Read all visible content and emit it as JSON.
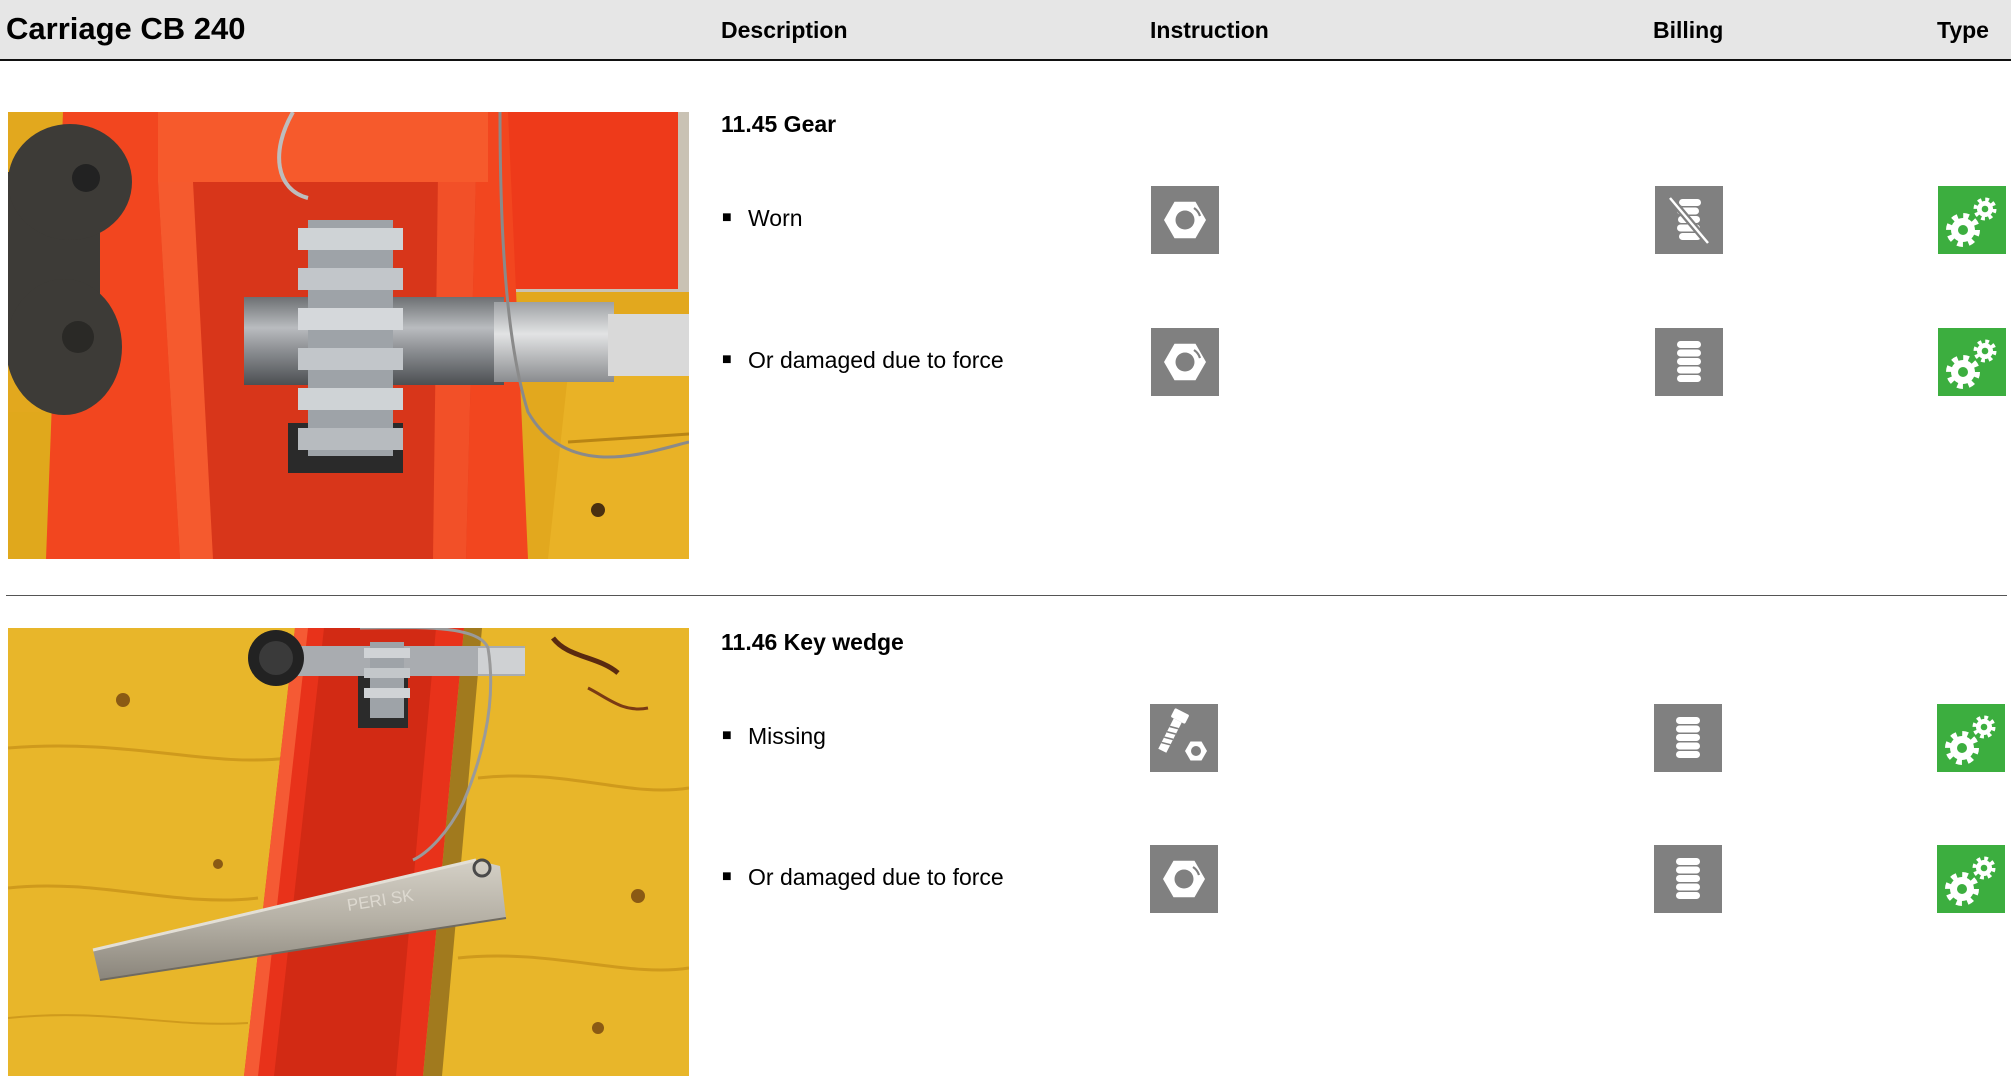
{
  "header": {
    "title": "Carriage CB 240",
    "columns": {
      "description": "Description",
      "instruction": "Instruction",
      "billing": "Billing",
      "type": "Type"
    }
  },
  "bullet": "■",
  "sections": [
    {
      "title": "11.45 Gear",
      "rows": [
        {
          "text": "Worn",
          "instruction_icon": "hex-nut-icon",
          "billing_icon": "no-billing-coins-icon",
          "type_icon": "gears-icon"
        },
        {
          "text": "Or damaged due to force",
          "instruction_icon": "hex-nut-icon",
          "billing_icon": "coin-stack-icon",
          "type_icon": "gears-icon"
        }
      ]
    },
    {
      "title": "11.46 Key wedge",
      "photo_lettering": "PERI SK",
      "rows": [
        {
          "text": "Missing",
          "instruction_icon": "bolt-nut-icon",
          "billing_icon": "coin-stack-icon",
          "type_icon": "gears-icon"
        },
        {
          "text": "Or damaged due to force",
          "instruction_icon": "hex-nut-icon",
          "billing_icon": "coin-stack-icon",
          "type_icon": "gears-icon"
        }
      ]
    }
  ],
  "colors": {
    "header_bg": "#e6e6e6",
    "icon_gray": "#808080",
    "icon_green": "#3cae3f"
  }
}
